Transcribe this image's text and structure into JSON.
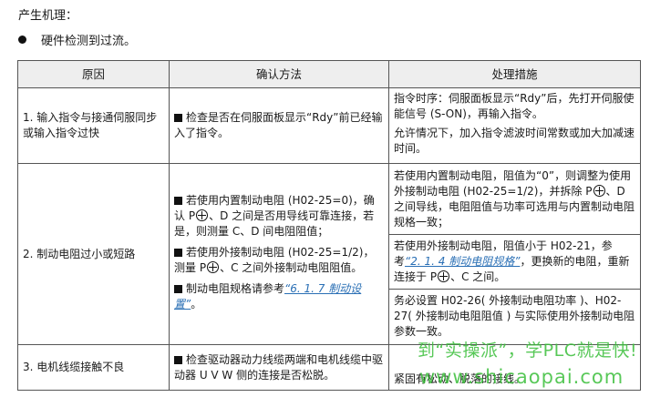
{
  "heading": "产生机理：",
  "bullet": "硬件检测到过流。",
  "table": {
    "headers": [
      "原因",
      "确认方法",
      "处理措施"
    ],
    "row1": {
      "cause": "1. 输入指令与接通伺服同步或输入指令过快",
      "check": "检查是否在伺服面板显示“Rdy”前已经输入了指令。",
      "action1": "指令时序：伺服面板显示“Rdy”后，先打开伺服使能信号 (S-ON)，再输入指令。",
      "action2": "允许情况下，加入指令滤波时间常数或加大加减速时间。"
    },
    "row2": {
      "cause": "2. 制动电阻过小或短路",
      "check1_a": "若使用内置制动电阻 (H02-25=0)，确认 P",
      "check1_b": "、D 之间是否用导线可靠连接，若是，则测量 C、D 间电阻阻值；",
      "check2_a": "若使用外接制动电阻 (H02-25=1/2)，测量 P",
      "check2_b": "、C 之间外接制动电阻阻值。",
      "check3_a": "制动电阻规格请参考",
      "check3_link": "“6. 1. 7  制动设置”",
      "check3_b": "。",
      "action1_a": "若使用内置制动电阻，阻值为“0”，则调整为使用外接制动电阻 (H02-25=1/2)，并拆除 P",
      "action1_b": "、D 之间导线，电阻阻值与功率可选用与内置制动电阻规格一致；",
      "action2_a": "若使用外接制动电阻，阻值小于 H02-21，参考",
      "action2_link": "“2. 1. 4  制动电阻规格”",
      "action2_b": "，更换新的电阻，重新连接于 P",
      "action2_c": "、C 之间。",
      "action3": "务必设置 H02-26( 外接制动电阻功率 )、H02-27( 外接制动电阻阻值 ) 与实际使用外接制动电阻参数一致。"
    },
    "row3": {
      "cause": "3. 电机线缆接触不良",
      "check": "检查驱动器动力线缆两端和电机线缆中驱动器 U V W 侧的连接是否松脱。",
      "action": "紧固有松动、脱落的接线。"
    }
  },
  "watermark": {
    "line1": "到“实操派”，学PLC就是快!",
    "line2": "www.shicaopai.com"
  }
}
